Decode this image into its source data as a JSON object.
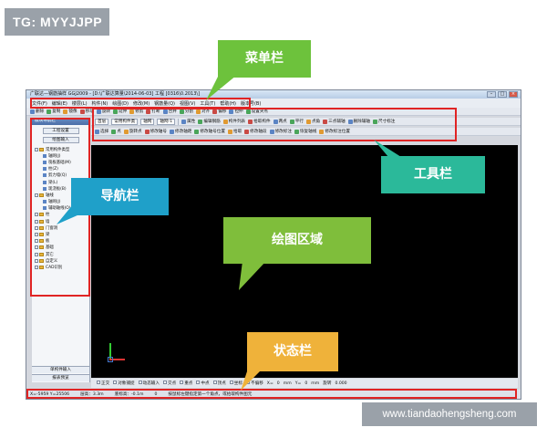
{
  "tag": "TG: MYYJJPP",
  "watermark": "www.tiandaohengsheng.com",
  "window": {
    "title": "广联达—钢筋抽样 GGJ2009 - [D:\\广联达算量\\2014-06-03] 工程 [0316\\0.2013\\]"
  },
  "menu": [
    "文件(F)",
    "编辑(E)",
    "楼层(L)",
    "构件(N)",
    "绘图(D)",
    "修改(M)",
    "钢筋量(Q)",
    "视图(V)",
    "工具(T)",
    "帮助(H)",
    "版本号(B)"
  ],
  "toolbar": {
    "row1": [
      "删除",
      "复制",
      "镜像",
      "移动",
      "旋转",
      "延伸",
      "修剪",
      "打断",
      "合并",
      "分割",
      "对齐",
      "偏移",
      "拉伸",
      "设置夹点"
    ],
    "row2": {
      "floor": "首层",
      "category": "常用构件类",
      "type": "轴网",
      "name": "轴网-1",
      "items": [
        "属性",
        "编辑钢筋",
        "构件列表",
        "拾取构件",
        "两点",
        "平行",
        "点角",
        "三点辅轴",
        "删除辅轴",
        "尺寸标注"
      ]
    },
    "row3": [
      "选择",
      "点",
      "旋转点",
      "修改轴号",
      "修改轴距",
      "修改轴号位置",
      "拾取",
      "修改轴段",
      "修改标注",
      "恢复轴线",
      "修改标注位置"
    ]
  },
  "nav": {
    "head": "模块导航栏",
    "btn1": "工程设置",
    "btn2": "绘图输入",
    "tree": [
      {
        "label": "常用构件类型",
        "kind": "folder"
      },
      {
        "label": "轴网(J)",
        "kind": "leaf"
      },
      {
        "label": "筏板基础(M)",
        "kind": "leaf"
      },
      {
        "label": "柱(Z)",
        "kind": "leaf"
      },
      {
        "label": "剪力墙(Q)",
        "kind": "leaf"
      },
      {
        "label": "梁(L)",
        "kind": "leaf"
      },
      {
        "label": "现浇板(B)",
        "kind": "leaf"
      },
      {
        "label": "轴线",
        "kind": "folder"
      },
      {
        "label": "轴网(J)",
        "kind": "leaf"
      },
      {
        "label": "辅助轴线(O)",
        "kind": "leaf"
      },
      {
        "label": "柱",
        "kind": "folder"
      },
      {
        "label": "墙",
        "kind": "folder"
      },
      {
        "label": "门窗洞",
        "kind": "folder"
      },
      {
        "label": "梁",
        "kind": "folder"
      },
      {
        "label": "板",
        "kind": "folder"
      },
      {
        "label": "基础",
        "kind": "folder"
      },
      {
        "label": "其它",
        "kind": "folder"
      },
      {
        "label": "自定义",
        "kind": "folder"
      },
      {
        "label": "CAD识别",
        "kind": "folder"
      }
    ],
    "foot1": "单构件输入",
    "foot2": "报表预览"
  },
  "bottombar": [
    "正交",
    "对象捕捉",
    "动态输入",
    "交点",
    "重点",
    "中点",
    "顶点",
    "坐标",
    "不偏移",
    "X=",
    "0",
    "mm",
    "Y=",
    "0",
    "mm",
    "旋转",
    "0.000"
  ],
  "statusbar": [
    "X=-5959 Y=25506",
    "层高：3.3m",
    "底标高：-0.1m",
    "0",
    "按鼠标左键指定第一个角点，或拾取构件图元"
  ],
  "callouts": {
    "menu": "菜单栏",
    "nav": "导航栏",
    "toolbar": "工具栏",
    "drawing": "绘图区域",
    "status": "状态栏"
  }
}
